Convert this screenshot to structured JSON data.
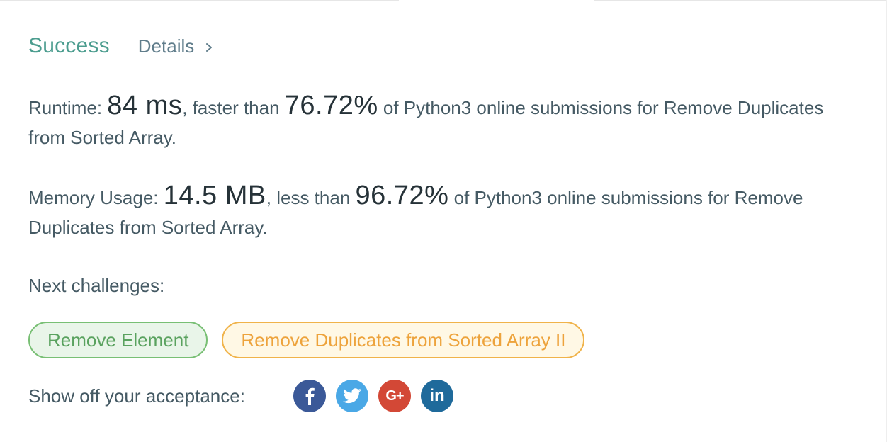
{
  "status": {
    "label": "Success",
    "details_label": "Details"
  },
  "runtime": {
    "prefix": "Runtime: ",
    "value": "84 ms",
    "middle": ", faster than ",
    "percent": "76.72%",
    "suffix": " of Python3 online submissions for Remove Duplicates from Sorted Array."
  },
  "memory": {
    "prefix": "Memory Usage: ",
    "value": "14.5 MB",
    "middle": ", less than ",
    "percent": "96.72%",
    "suffix": " of Python3 online submissions for Remove Duplicates from Sorted Array."
  },
  "next": {
    "label": "Next challenges:",
    "challenges": [
      {
        "title": "Remove Element",
        "difficulty": "easy"
      },
      {
        "title": "Remove Duplicates from Sorted Array II",
        "difficulty": "medium"
      }
    ]
  },
  "share": {
    "label": "Show off your acceptance:",
    "networks": [
      {
        "icon": "facebook-icon",
        "glyph": "f",
        "color": "#3b5998"
      },
      {
        "icon": "twitter-icon",
        "glyph": "",
        "color": "#4aa8e6"
      },
      {
        "icon": "google-plus-icon",
        "glyph": "G+",
        "color": "#d34836"
      },
      {
        "icon": "linkedin-icon",
        "glyph": "in",
        "color": "#1f6a9b"
      }
    ]
  },
  "colors": {
    "success": "#4c9d8f",
    "easy_border": "#78bf74",
    "medium_border": "#f0b34a"
  }
}
